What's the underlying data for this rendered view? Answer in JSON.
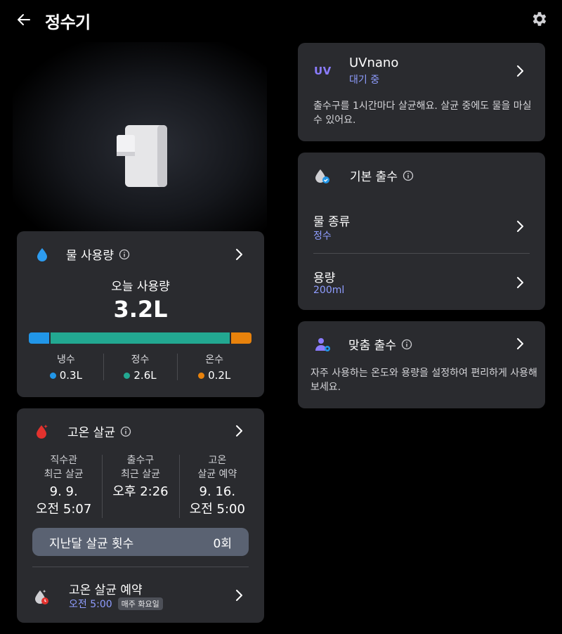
{
  "header": {
    "title": "정수기"
  },
  "water_usage": {
    "title": "물 사용량",
    "today_label": "오늘 사용량",
    "today_value": "3.2L",
    "bar_fractions": {
      "cold": 0.094,
      "purified": 0.8125,
      "hot": 0.094
    },
    "legend": [
      {
        "name": "냉수",
        "value": "0.3L",
        "color": "#2196e8"
      },
      {
        "name": "정수",
        "value": "2.6L",
        "color": "#22a891"
      },
      {
        "name": "온수",
        "value": "0.2L",
        "color": "#e8820c"
      }
    ]
  },
  "sterilization": {
    "title": "고온 살균",
    "stats": [
      {
        "label": "직수관\n최근 살균",
        "value": "9. 9.\n오전 5:07"
      },
      {
        "label": "출수구\n최근 살균",
        "value": "오후 2:26"
      },
      {
        "label": "고온\n살균 예약",
        "value": "9. 16.\n오전 5:00"
      }
    ],
    "count_label": "지난달 살균 횟수",
    "count_value": "0회",
    "schedule_title": "고온 살균 예약",
    "schedule_time": "오전 5:00",
    "schedule_badge": "매주 화요일"
  },
  "uv": {
    "icon_text": "UV",
    "name": "UVnano",
    "status": "대기 중",
    "description": "출수구를 1시간마다 살균해요. 살균 중에도 물을 마실 수 있어요."
  },
  "basic_dispense": {
    "title": "기본 출수",
    "water_type_label": "물 종류",
    "water_type_value": "정수",
    "volume_label": "용량",
    "volume_value": "200ml"
  },
  "custom_dispense": {
    "title": "맞춤 출수",
    "description": "자주 사용하는 온도와 용량을 설정하여 편리하게 사용해보세요."
  },
  "colors": {
    "accent": "#8f9dff",
    "card": "#2a2b2f",
    "background": "#000000"
  }
}
